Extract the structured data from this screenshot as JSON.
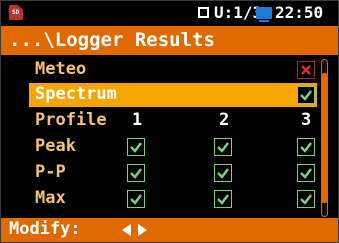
{
  "status": {
    "page_indicator": "U:1/3",
    "time": "22:50",
    "sd_icon_label": "SD"
  },
  "title": "...\\Logger Results",
  "rows": [
    {
      "label": "Meteo",
      "checks": [
        "off-red"
      ]
    },
    {
      "label": "Spectrum",
      "checks": [
        "on"
      ],
      "selected": true
    },
    {
      "label": "Profile",
      "columns": [
        "1",
        "2",
        "3"
      ]
    },
    {
      "label": "Peak",
      "checks": [
        "on",
        "on",
        "on"
      ]
    },
    {
      "label": "P-P",
      "checks": [
        "on",
        "on",
        "on"
      ]
    },
    {
      "label": "Max",
      "checks": [
        "on",
        "on",
        "on"
      ]
    }
  ],
  "hint": "Modify:",
  "colors": {
    "accent": "#e06a00",
    "selected": "#f7a500",
    "label": "#f4c27a",
    "check": "#7ed080",
    "cross": "#e0302a"
  }
}
